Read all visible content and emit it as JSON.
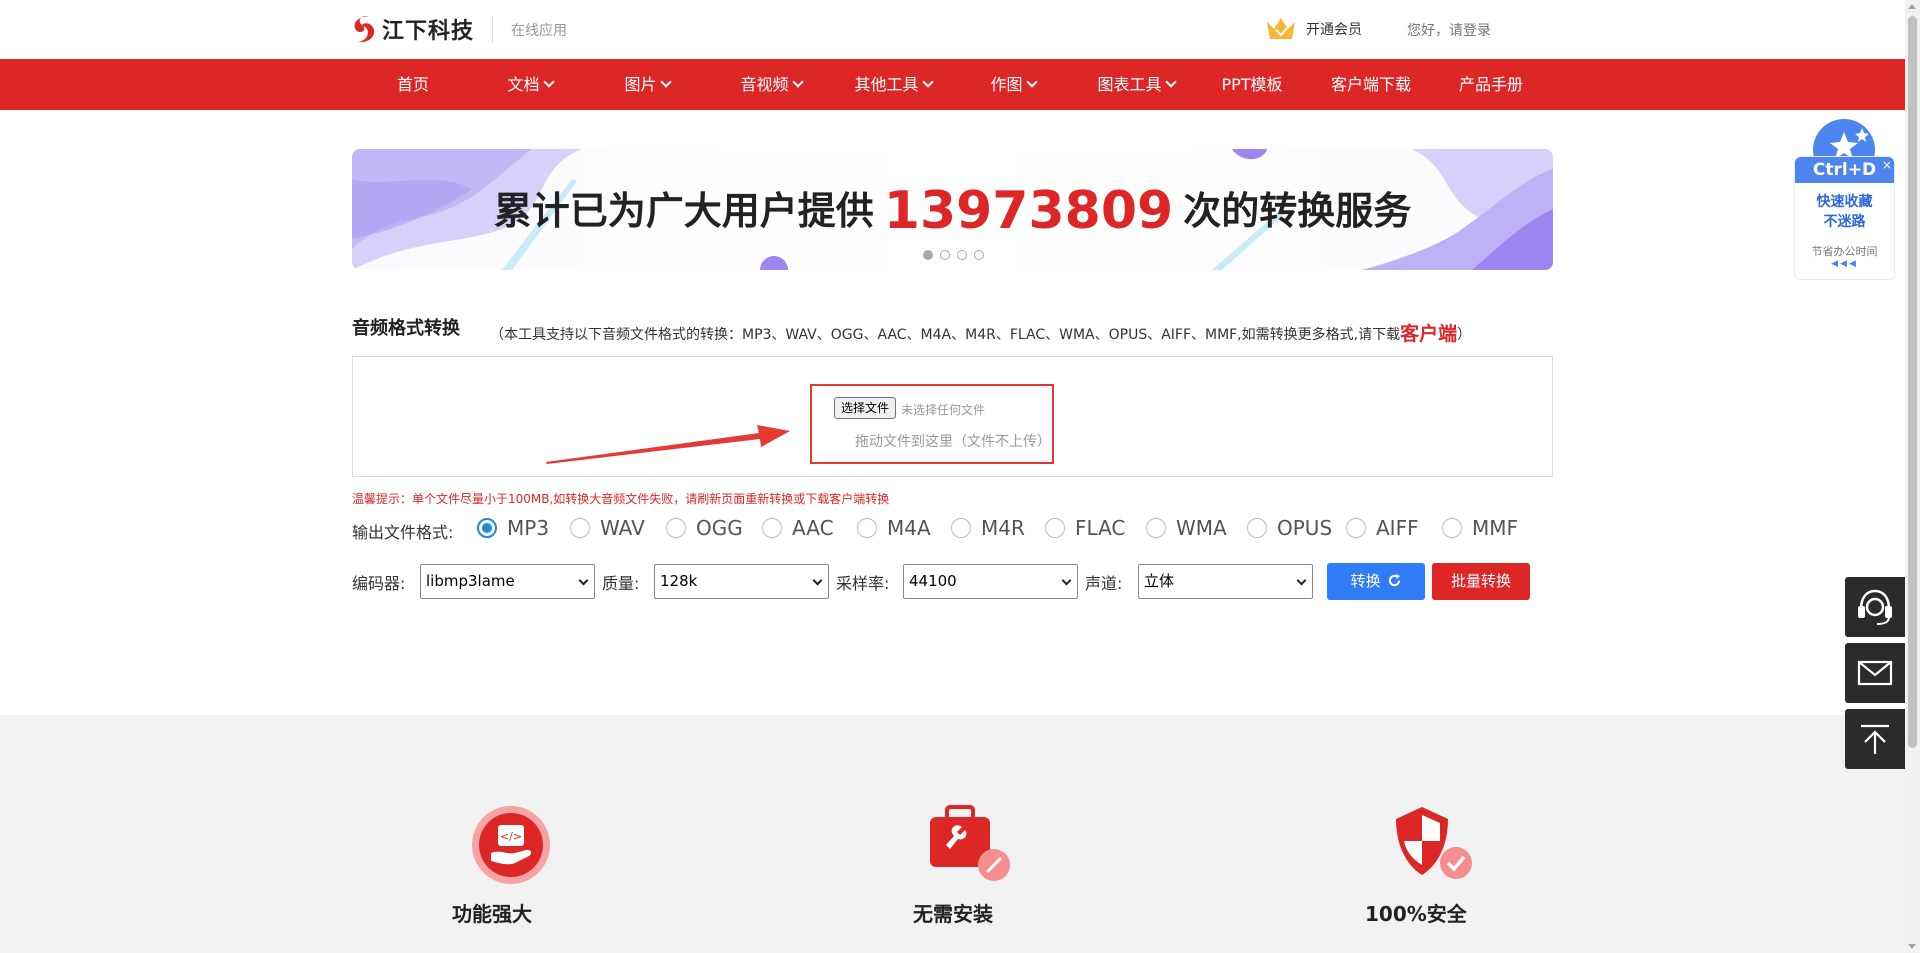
{
  "header": {
    "brand": "江下科技",
    "sub": "在线应用",
    "vip": "开通会员",
    "login": "您好，请登录"
  },
  "nav": [
    {
      "label": "首页",
      "has_menu": false
    },
    {
      "label": "文档",
      "has_menu": true
    },
    {
      "label": "图片",
      "has_menu": true
    },
    {
      "label": "音视频",
      "has_menu": true
    },
    {
      "label": "其他工具",
      "has_menu": true
    },
    {
      "label": "作图",
      "has_menu": true
    },
    {
      "label": "图表工具",
      "has_menu": true
    },
    {
      "label": "PPT模板",
      "has_menu": false
    },
    {
      "label": "客户端下载",
      "has_menu": false
    },
    {
      "label": "产品手册",
      "has_menu": false
    }
  ],
  "banner": {
    "prefix": "累计已为广大用户提供",
    "count": "13973809",
    "suffix": "次的转换服务",
    "slides": 4,
    "active_slide": 0
  },
  "tool": {
    "title": "音频格式转换",
    "note_prefix": "（本工具支持以下音频文件格式的转换：MP3、WAV、OGG、AAC、M4A、M4R、FLAC、WMA、OPUS、AIFF、MMF,如需转换更多格式,请下载",
    "note_link": "客户端",
    "note_suffix": "）",
    "file_button": "选择文件",
    "file_status": "未选择任何文件",
    "drop_hint": "拖动文件到这里（文件不上传）",
    "tip": "温馨提示：单个文件尽量小于100MB,如转换大音频文件失败，请刷新页面重新转换或下载客户端转换"
  },
  "output": {
    "label": "输出文件格式:",
    "selected": "MP3",
    "formats": [
      "MP3",
      "WAV",
      "OGG",
      "AAC",
      "M4A",
      "M4R",
      "FLAC",
      "WMA",
      "OPUS",
      "AIFF",
      "MMF"
    ]
  },
  "options": {
    "encoder_label": "编码器:",
    "encoder": "libmp3lame",
    "quality_label": "质量:",
    "quality": "128k",
    "rate_label": "采样率:",
    "rate": "44100",
    "channel_label": "声道:",
    "channel": "立体",
    "convert_label": "转换",
    "batch_label": "批量转换"
  },
  "features": [
    {
      "title": "功能强大"
    },
    {
      "title": "无需安装"
    },
    {
      "title": "100%安全"
    }
  ],
  "ctrl_widget": {
    "shortcut": "Ctrl+D",
    "close": "×",
    "line1": "快速收藏",
    "line2": "不迷路",
    "line3": "节省办公时间",
    "arrows": "◀◀◀"
  },
  "colors": {
    "brand_red": "#dd2727",
    "convert_blue": "#2f7cf6",
    "radio_blue": "#1e88e5"
  }
}
